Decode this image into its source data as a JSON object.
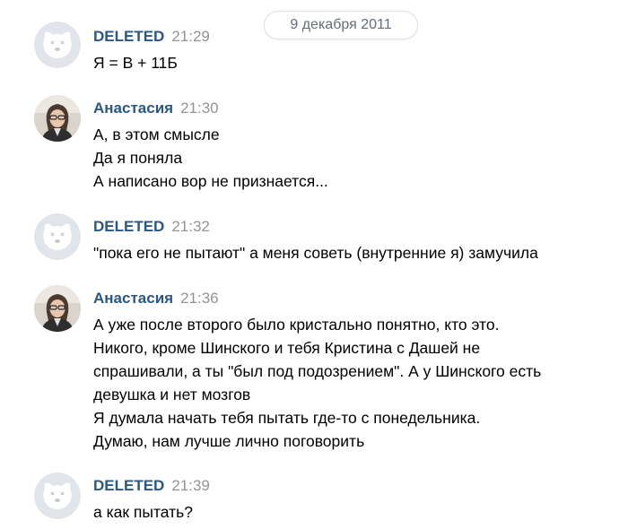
{
  "date_separator": "9 декабря 2011",
  "messages": [
    {
      "author": "DELETED",
      "time": "21:29",
      "avatar": "deleted-dog-icon",
      "lines": [
        "Я = В + 11Б"
      ]
    },
    {
      "author": "Анастасия",
      "time": "21:30",
      "avatar": "user-photo",
      "lines": [
        "А, в этом смысле",
        "Да я поняла",
        "А написано вор не признается..."
      ]
    },
    {
      "author": "DELETED",
      "time": "21:32",
      "avatar": "deleted-dog-icon",
      "lines": [
        "\"пока его не пытают\" а меня советь (внутренние я) замучила"
      ]
    },
    {
      "author": "Анастасия",
      "time": "21:36",
      "avatar": "user-photo",
      "lines": [
        "А уже после второго было кристально понятно, кто это.",
        "Никого, кроме Шинского и тебя Кристина с Дашей не",
        "спрашивали, а ты \"был под подозрением\". А у Шинского есть",
        "девушка и нет мозгов",
        "Я думала начать тебя пытать где-то с понедельника.",
        "Думаю, нам лучше лично поговорить"
      ]
    },
    {
      "author": "DELETED",
      "time": "21:39",
      "avatar": "deleted-dog-icon",
      "lines": [
        "а как пытать?"
      ]
    }
  ],
  "colors": {
    "author_link": "#2a5885",
    "timestamp": "#939393",
    "deleted_avatar_bg": "#e1e5eb",
    "deleted_avatar_fg": "#ffffff"
  }
}
